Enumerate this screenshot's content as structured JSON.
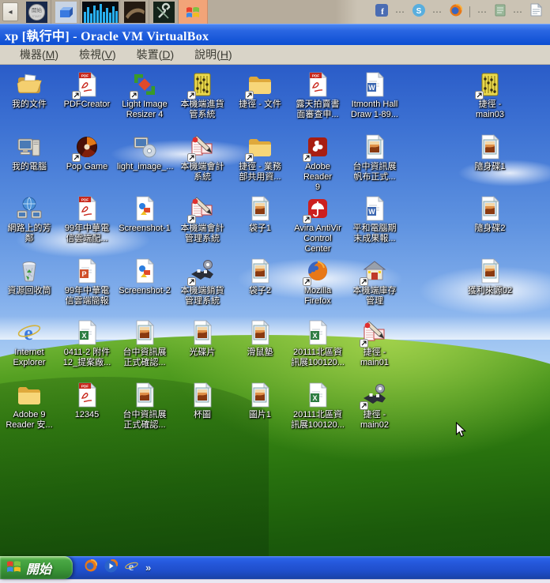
{
  "host_bar": {
    "back_button_glyph": "◂",
    "tiles": [
      {
        "name": "start-orb-tile",
        "label": "開始",
        "sublabel": "START"
      },
      {
        "name": "blue-box-tile"
      },
      {
        "name": "equalizer-tile"
      },
      {
        "name": "leather-app-tile"
      },
      {
        "name": "toolbox-tile"
      },
      {
        "name": "xp-vm-tile",
        "active": true
      }
    ],
    "tray": [
      {
        "type": "facebook",
        "name": "facebook-icon"
      },
      {
        "type": "ellipsis",
        "text": "⋯"
      },
      {
        "type": "skype",
        "name": "skype-icon"
      },
      {
        "type": "ellipsis",
        "text": "⋯"
      },
      {
        "type": "firefox-mini",
        "name": "firefox-icon"
      },
      {
        "type": "divider"
      },
      {
        "type": "ellipsis",
        "text": "⋯"
      },
      {
        "type": "notes",
        "name": "notes-icon"
      },
      {
        "type": "ellipsis",
        "text": "⋯"
      },
      {
        "type": "writer",
        "name": "writer-document-icon"
      }
    ]
  },
  "virtualbox": {
    "title": "xp [執行中] - Oracle VM VirtualBox",
    "menus": [
      {
        "pre": "機器(",
        "key": "M",
        "post": ")"
      },
      {
        "pre": "檢視(",
        "key": "V",
        "post": ")"
      },
      {
        "pre": "裝置(",
        "key": "D",
        "post": ")"
      },
      {
        "pre": "說明(",
        "key": "H",
        "post": ")"
      }
    ]
  },
  "desktop": {
    "icons": [
      {
        "id": "my-documents",
        "label": "我的文件",
        "icon": "my-documents",
        "col": 0,
        "row": 0,
        "shortcut": false
      },
      {
        "id": "pdfcreator",
        "label": "PDFCreator",
        "icon": "pdf-file",
        "col": 1,
        "row": 0,
        "shortcut": true
      },
      {
        "id": "light-image-resizer-4",
        "label": "Light Image\nResizer 4",
        "icon": "image-resizer",
        "col": 2,
        "row": 0,
        "shortcut": true
      },
      {
        "id": "purchase-system",
        "label": "本機端進貨\n管系統",
        "icon": "abacus",
        "col": 3,
        "row": 0,
        "shortcut": true
      },
      {
        "id": "shortcut-documents",
        "label": "捷徑 - 文件",
        "icon": "folder",
        "col": 4,
        "row": 0,
        "shortcut": true
      },
      {
        "id": "ruten-review-pdf",
        "label": "露天拍賣書\n面審查申...",
        "icon": "pdf-file",
        "col": 5,
        "row": 0,
        "shortcut": false
      },
      {
        "id": "itmonth-hall-doc",
        "label": "Itmonth Hall\nDraw 1-89...",
        "icon": "word-doc",
        "col": 6,
        "row": 0,
        "shortcut": false
      },
      {
        "id": "shortcut-main03",
        "label": "捷徑 -\nmain03",
        "icon": "abacus",
        "col": 8,
        "row": 0,
        "shortcut": true
      },
      {
        "id": "my-computer",
        "label": "我的電腦",
        "icon": "computer",
        "col": 0,
        "row": 1,
        "shortcut": false
      },
      {
        "id": "pop-game",
        "label": "Pop Game",
        "icon": "pop-game",
        "col": 1,
        "row": 1,
        "shortcut": true
      },
      {
        "id": "light-image-installer",
        "label": "light_image_...",
        "icon": "installer",
        "col": 2,
        "row": 1,
        "shortcut": false
      },
      {
        "id": "accounting-system",
        "label": "本機端會計\n系統",
        "icon": "pen",
        "col": 3,
        "row": 1,
        "shortcut": true
      },
      {
        "id": "shortcut-sales-share",
        "label": "捷徑 - 業務\n部共用資...",
        "icon": "folder",
        "col": 4,
        "row": 1,
        "shortcut": true
      },
      {
        "id": "adobe-reader-9",
        "label": "Adobe Reader\n9",
        "icon": "adobe-reader",
        "col": 5,
        "row": 1,
        "shortcut": true
      },
      {
        "id": "taichung-expo-banner",
        "label": "台中資訊展\n帆布正式...",
        "icon": "photo-file",
        "col": 6,
        "row": 1,
        "shortcut": false
      },
      {
        "id": "usb-drive-1",
        "label": "隨身碟1",
        "icon": "photo-file",
        "col": 8,
        "row": 1,
        "shortcut": false
      },
      {
        "id": "network-places",
        "label": "網路上的芳\n鄰",
        "icon": "network",
        "col": 0,
        "row": 2,
        "shortcut": false
      },
      {
        "id": "cht-cloud-pdf",
        "label": "99年中華電\n信雲端配...",
        "icon": "pdf-file",
        "col": 1,
        "row": 2,
        "shortcut": false
      },
      {
        "id": "screenshot-1",
        "label": "Screenshot-1",
        "icon": "picture-file",
        "col": 2,
        "row": 2,
        "shortcut": false
      },
      {
        "id": "accounting-mgmt",
        "label": "本機端會計\n管理系統",
        "icon": "pen",
        "col": 3,
        "row": 2,
        "shortcut": true
      },
      {
        "id": "bag-1",
        "label": "袋子1",
        "icon": "photo-file",
        "col": 4,
        "row": 2,
        "shortcut": false
      },
      {
        "id": "avira-antivir",
        "label": "Avira AntiVir\nControl Center",
        "icon": "avira",
        "col": 5,
        "row": 2,
        "shortcut": true
      },
      {
        "id": "pinghe-report-doc",
        "label": "平和電腦期\n末成果報...",
        "icon": "word-doc",
        "col": 6,
        "row": 2,
        "shortcut": false
      },
      {
        "id": "usb-drive-2",
        "label": "隨身碟2",
        "icon": "photo-file",
        "col": 8,
        "row": 2,
        "shortcut": false
      },
      {
        "id": "recycle-bin",
        "label": "資源回收筒",
        "icon": "recycle-bin",
        "col": 0,
        "row": 3,
        "shortcut": false
      },
      {
        "id": "cht-cloud-ppt",
        "label": "99年中華電\n信雲端簡報",
        "icon": "ppt-doc",
        "col": 1,
        "row": 3,
        "shortcut": false
      },
      {
        "id": "screenshot-2",
        "label": "Screenshot-2",
        "icon": "picture-file",
        "col": 2,
        "row": 3,
        "shortcut": false
      },
      {
        "id": "sales-mgmt-system",
        "label": "本機端銷貨\n管理系統",
        "icon": "handshake",
        "col": 3,
        "row": 3,
        "shortcut": true
      },
      {
        "id": "bag-2",
        "label": "袋子2",
        "icon": "photo-file",
        "col": 4,
        "row": 3,
        "shortcut": false
      },
      {
        "id": "mozilla-firefox",
        "label": "Mozilla\nFirefox",
        "icon": "firefox",
        "col": 5,
        "row": 3,
        "shortcut": true
      },
      {
        "id": "inventory-mgmt",
        "label": "本機端庫存\n管理",
        "icon": "warehouse",
        "col": 6,
        "row": 3,
        "shortcut": true
      },
      {
        "id": "profit-source-02",
        "label": "獲利來源02",
        "icon": "photo-file",
        "col": 8,
        "row": 3,
        "shortcut": false
      },
      {
        "id": "internet-explorer",
        "label": "Internet\nExplorer",
        "icon": "ie",
        "col": 0,
        "row": 4,
        "shortcut": false
      },
      {
        "id": "attachment-12-excel",
        "label": "0411-2 附件\n12_提案廠...",
        "icon": "excel-doc",
        "col": 1,
        "row": 4,
        "shortcut": false
      },
      {
        "id": "taichung-expo-confirm1",
        "label": "台中資訊展\n正式確認...",
        "icon": "photo-file",
        "col": 2,
        "row": 4,
        "shortcut": false
      },
      {
        "id": "optical-disc",
        "label": "光碟片",
        "icon": "photo-file",
        "col": 3,
        "row": 4,
        "shortcut": false
      },
      {
        "id": "mouse-pad",
        "label": "滑鼠墊",
        "icon": "photo-file",
        "col": 4,
        "row": 4,
        "shortcut": false
      },
      {
        "id": "north-expo-excel-1",
        "label": "20111北區資\n訊展100120...",
        "icon": "excel-doc",
        "col": 5,
        "row": 4,
        "shortcut": false
      },
      {
        "id": "shortcut-main01",
        "label": "捷徑 -\nmain01",
        "icon": "pen",
        "col": 6,
        "row": 4,
        "shortcut": true
      },
      {
        "id": "adobe9-reader-folder",
        "label": "Adobe 9\nReader 安...",
        "icon": "folder",
        "col": 0,
        "row": 5,
        "shortcut": false
      },
      {
        "id": "pdf-12345",
        "label": "12345",
        "icon": "pdf-file",
        "col": 1,
        "row": 5,
        "shortcut": false
      },
      {
        "id": "taichung-expo-confirm2",
        "label": "台中資訊展\n正式確認...",
        "icon": "photo-file",
        "col": 2,
        "row": 5,
        "shortcut": false
      },
      {
        "id": "cup-image",
        "label": "杯圖",
        "icon": "photo-file",
        "col": 3,
        "row": 5,
        "shortcut": false
      },
      {
        "id": "image-1",
        "label": "圖片1",
        "icon": "photo-file",
        "col": 4,
        "row": 5,
        "shortcut": false
      },
      {
        "id": "north-expo-excel-2",
        "label": "20111北區資\n訊展100120...",
        "icon": "excel-doc",
        "col": 5,
        "row": 5,
        "shortcut": false
      },
      {
        "id": "shortcut-main02",
        "label": "捷徑 -\nmain02",
        "icon": "handshake",
        "col": 6,
        "row": 5,
        "shortcut": true
      }
    ]
  },
  "taskbar": {
    "start_label": "開始",
    "quick_launch": [
      {
        "type": "firefox-mini",
        "name": "firefox-quicklaunch-icon"
      },
      {
        "type": "media-player",
        "name": "media-player-quicklaunch-icon"
      },
      {
        "type": "ie-mini",
        "name": "internet-explorer-quicklaunch-icon"
      },
      {
        "type": "chevron",
        "text": "»",
        "name": "quicklaunch-more-chevron"
      }
    ]
  },
  "colors": {
    "title_bar_blue": "#1655d6",
    "menu_beige": "#d9d4c8",
    "taskbar_blue": "#2456d8",
    "start_green": "#3c9838",
    "sky_blue": "#3f74d4",
    "grass_green": "#2f7a10",
    "host_bar_tan": "#b6ac9c"
  }
}
